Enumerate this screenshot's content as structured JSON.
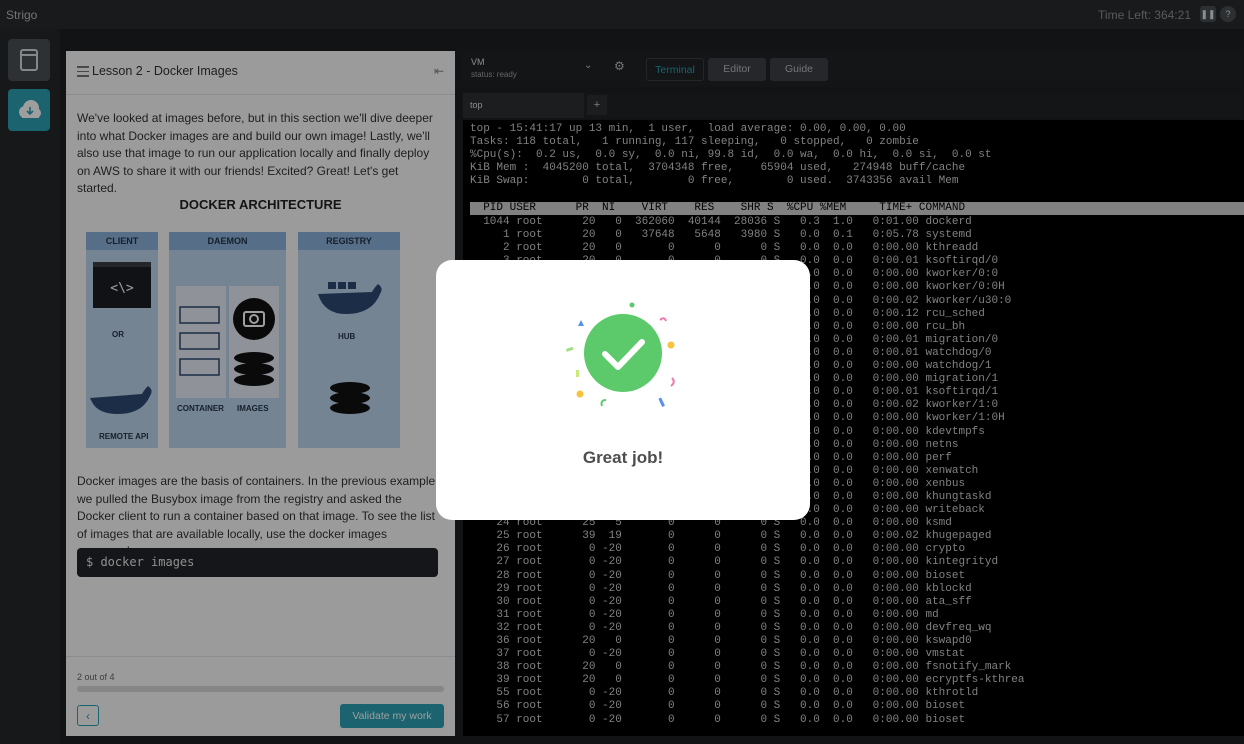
{
  "app": {
    "brand": "Strigo",
    "time_left": "Time Left: 364:21"
  },
  "lesson": {
    "title": "Lesson 2 - Docker Images",
    "intro": "We've looked at images before, but in this section we'll dive deeper into what Docker images are and build our own image! Lastly, we'll also use that image to run our application locally and finally deploy on AWS to share it with our friends! Excited? Great! Let's get started.",
    "diagram": {
      "title": "DOCKER ARCHITECTURE",
      "client": "CLIENT",
      "daemon": "DAEMON",
      "registry": "REGISTRY",
      "or": "OR",
      "remote_api": "REMOTE API",
      "container": "CONTAINER",
      "images": "IMAGES",
      "hub": "HUB"
    },
    "body2": "Docker images are the basis of containers. In the previous example, we pulled the Busybox image from the registry and asked the Docker client to run a container based on that image. To see the list of images that are available locally, use the docker images command.",
    "code": "$ docker images",
    "progress": {
      "label": "2 out of 4",
      "fraction": 0.0
    },
    "validate_label": "Validate my work"
  },
  "vm": {
    "name": "VM",
    "status": "status: ready"
  },
  "tabs": [
    "Terminal",
    "Editor",
    "Guide"
  ],
  "terminal": {
    "tab_name": "top",
    "summary": "top - 15:41:17 up 13 min,  1 user,  load average: 0.00, 0.00, 0.00\nTasks: 118 total,   1 running, 117 sleeping,   0 stopped,   0 zombie\n%Cpu(s):  0.2 us,  0.0 sy,  0.0 ni, 99.8 id,  0.0 wa,  0.0 hi,  0.0 si,  0.0 st\nKiB Mem :  4045200 total,  3704348 free,    65904 used,   274948 buff/cache\nKiB Swap:        0 total,        0 free,        0 used.  3743356 avail Mem",
    "header": "  PID USER      PR  NI    VIRT    RES    SHR S  %CPU %MEM     TIME+ COMMAND",
    "rows": "  1044 root      20   0  362060  40144  28036 S   0.3  1.0   0:01.00 dockerd\n     1 root      20   0   37648   5648   3980 S   0.0  0.1   0:05.78 systemd\n     2 root      20   0       0      0      0 S   0.0  0.0   0:00.00 kthreadd\n     3 root      20   0       0      0      0 S   0.0  0.0   0:00.01 ksoftirqd/0\n     4 root      20   0       0      0      0 S   0.0  0.0   0:00.00 kworker/0:0\n     5 root       0 -20       0      0      0 S   0.0  0.0   0:00.00 kworker/0:0H\n     6 root      20   0       0      0      0 S   0.0  0.0   0:00.02 kworker/u30:0\n     7 root      20   0       0      0      0 S   0.0  0.0   0:00.12 rcu_sched\n     8 root      20   0       0      0      0 S   0.0  0.0   0:00.00 rcu_bh\n     9 root      rt   0       0      0      0 S   0.0  0.0   0:00.01 migration/0\n    10 root      rt   0       0      0      0 S   0.0  0.0   0:00.01 watchdog/0\n    11 root      rt   0       0      0      0 S   0.0  0.0   0:00.00 watchdog/1\n    12 root      rt   0       0      0      0 S   0.0  0.0   0:00.00 migration/1\n    13 root      20   0       0      0      0 S   0.0  0.0   0:00.01 ksoftirqd/1\n    14 root      20   0       0      0      0 S   0.0  0.0   0:00.02 kworker/1:0\n    15 root       0 -20       0      0      0 S   0.0  0.0   0:00.00 kworker/1:0H\n    16 root      20   0       0      0      0 S   0.0  0.0   0:00.00 kdevtmpfs\n    17 root       0 -20       0      0      0 S   0.0  0.0   0:00.00 netns\n    18 root       0 -20       0      0      0 S   0.0  0.0   0:00.00 perf\n    19 root      20   0       0      0      0 S   0.0  0.0   0:00.00 xenwatch\n    20 root      20   0       0      0      0 S   0.0  0.0   0:00.00 xenbus\n    22 root      20   0       0      0      0 S   0.0  0.0   0:00.00 khungtaskd\n    23 root       0 -20       0      0      0 S   0.0  0.0   0:00.00 writeback\n    24 root      25   5       0      0      0 S   0.0  0.0   0:00.00 ksmd\n    25 root      39  19       0      0      0 S   0.0  0.0   0:00.02 khugepaged\n    26 root       0 -20       0      0      0 S   0.0  0.0   0:00.00 crypto\n    27 root       0 -20       0      0      0 S   0.0  0.0   0:00.00 kintegrityd\n    28 root       0 -20       0      0      0 S   0.0  0.0   0:00.00 bioset\n    29 root       0 -20       0      0      0 S   0.0  0.0   0:00.00 kblockd\n    30 root       0 -20       0      0      0 S   0.0  0.0   0:00.00 ata_sff\n    31 root       0 -20       0      0      0 S   0.0  0.0   0:00.00 md\n    32 root       0 -20       0      0      0 S   0.0  0.0   0:00.00 devfreq_wq\n    36 root      20   0       0      0      0 S   0.0  0.0   0:00.00 kswapd0\n    37 root       0 -20       0      0      0 S   0.0  0.0   0:00.00 vmstat\n    38 root      20   0       0      0      0 S   0.0  0.0   0:00.00 fsnotify_mark\n    39 root      20   0       0      0      0 S   0.0  0.0   0:00.00 ecryptfs-kthrea\n    55 root       0 -20       0      0      0 S   0.0  0.0   0:00.00 kthrotld\n    56 root       0 -20       0      0      0 S   0.0  0.0   0:00.00 bioset\n    57 root       0 -20       0      0      0 S   0.0  0.0   0:00.00 bioset"
  },
  "modal": {
    "message": "Great job!"
  },
  "colors": {
    "accent": "#2ba0b3",
    "success": "#5cc96b",
    "background": "#1d2023"
  }
}
